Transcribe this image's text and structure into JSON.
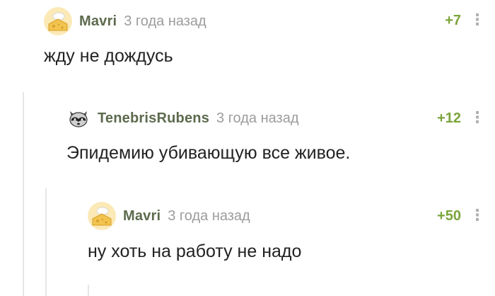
{
  "comments": [
    {
      "username": "Mavri",
      "time": "3 года назад",
      "rating": "+7",
      "text": "жду не дождусь",
      "avatar": "cheese-avatar-icon"
    },
    {
      "username": "TenebrisRubens",
      "time": "3 года назад",
      "rating": "+12",
      "text": "Эпидемию убивающую все живое.",
      "avatar": "raccoon-avatar-icon"
    },
    {
      "username": "Mavri",
      "time": "3 года назад",
      "rating": "+50",
      "text": "ну хоть на работу не надо",
      "avatar": "cheese-avatar-icon"
    }
  ],
  "colors": {
    "username": "#5c6a4d",
    "time": "#9c9c9c",
    "rating": "#7aa43b",
    "text": "#222222",
    "thread_line": "#e6e6e6"
  }
}
